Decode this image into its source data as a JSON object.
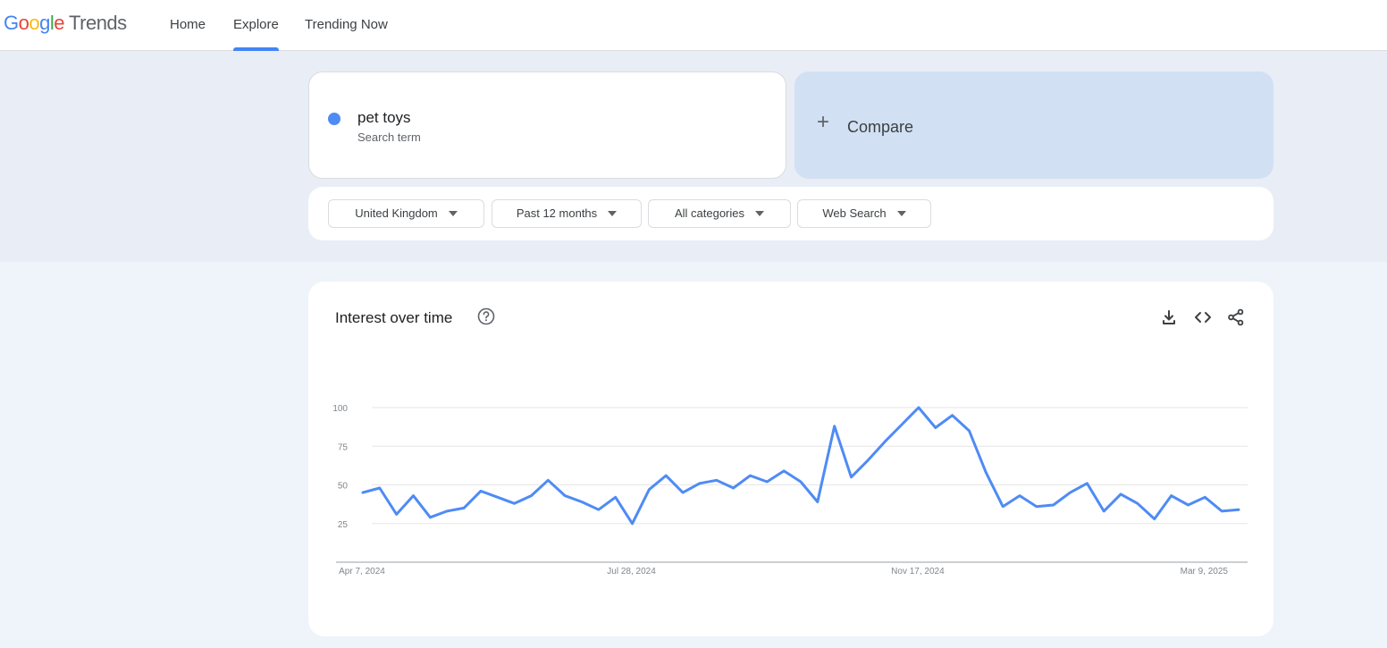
{
  "header": {
    "logo_letters": [
      "G",
      "o",
      "o",
      "g",
      "l",
      "e"
    ],
    "logo_product": "Trends",
    "nav": [
      {
        "label": "Home"
      },
      {
        "label": "Explore",
        "active": true
      },
      {
        "label": "Trending Now"
      }
    ]
  },
  "search": {
    "term": "pet toys",
    "term_type": "Search term",
    "term_color": "#4e8bf5",
    "compare_label": "Compare",
    "filters": [
      {
        "label": "United Kingdom"
      },
      {
        "label": "Past 12 months"
      },
      {
        "label": "All categories"
      },
      {
        "label": "Web Search"
      }
    ]
  },
  "interest": {
    "title": "Interest over time",
    "tools": [
      "download-icon",
      "embed-code-icon",
      "share-icon"
    ]
  },
  "chart_data": {
    "type": "line",
    "title": "Interest over time",
    "xlabel": "",
    "ylabel": "",
    "x_tick_labels": [
      "Apr 7, 2024",
      "Jul 28, 2024",
      "Nov 17, 2024",
      "Mar 9, 2025"
    ],
    "y_ticks": [
      25,
      50,
      75,
      100
    ],
    "ylim": [
      0,
      100
    ],
    "grid": true,
    "line_color": "#4e8bf5",
    "series": [
      {
        "name": "pet toys",
        "values": [
          45,
          48,
          31,
          43,
          29,
          33,
          35,
          46,
          42,
          38,
          43,
          53,
          43,
          39,
          34,
          42,
          25,
          47,
          56,
          45,
          51,
          53,
          48,
          56,
          52,
          59,
          52,
          39,
          88,
          55,
          66,
          78,
          89,
          100,
          87,
          95,
          85,
          58,
          36,
          43,
          36,
          37,
          45,
          51,
          33,
          44,
          38,
          28,
          43,
          37,
          42,
          33,
          34
        ]
      }
    ]
  }
}
